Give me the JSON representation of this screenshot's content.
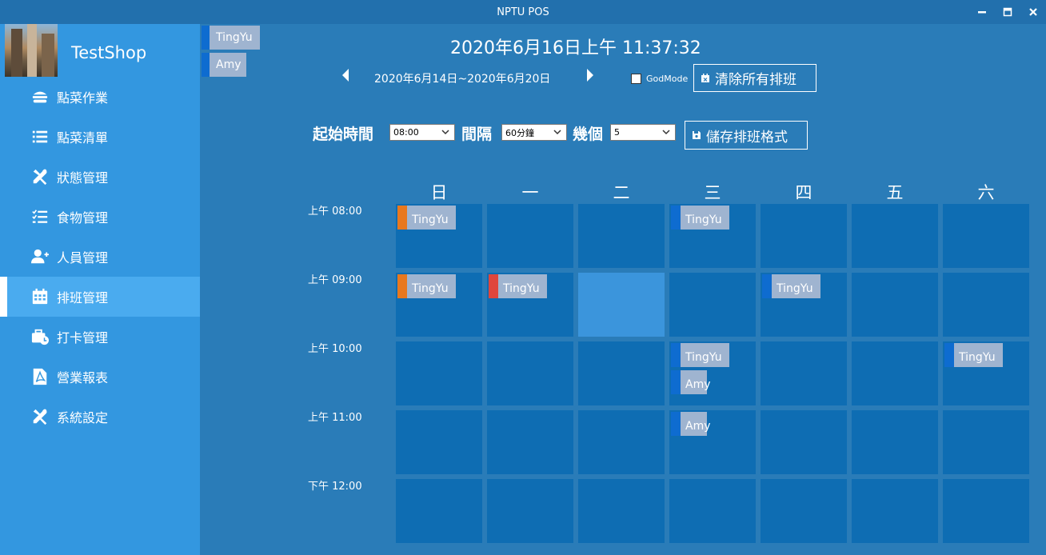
{
  "window": {
    "title": "NPTU POS"
  },
  "sidebar": {
    "shop_name": "TestShop",
    "items": [
      {
        "label": "點菜作業",
        "icon": "burger-icon",
        "active": false
      },
      {
        "label": "點菜清單",
        "icon": "list-icon",
        "active": false
      },
      {
        "label": "狀態管理",
        "icon": "tools-icon",
        "active": false
      },
      {
        "label": "食物管理",
        "icon": "checklist-icon",
        "active": false
      },
      {
        "label": "人員管理",
        "icon": "user-plus-icon",
        "active": false
      },
      {
        "label": "排班管理",
        "icon": "calendar-icon",
        "active": true
      },
      {
        "label": "打卡管理",
        "icon": "briefcase-clock-icon",
        "active": false
      },
      {
        "label": "營業報表",
        "icon": "pdf-file-icon",
        "active": false
      },
      {
        "label": "系統設定",
        "icon": "tools-icon",
        "active": false
      }
    ]
  },
  "employees": [
    "TingYu",
    "Amy"
  ],
  "header": {
    "datetime": "2020年6月16日上午 11:37:32",
    "week_range": "2020年6月14日~2020年6月20日",
    "godmode_label": "GodMode",
    "godmode_checked": false,
    "clear_button": "清除所有排班"
  },
  "options": {
    "start_label": "起始時間",
    "start_value": "08:00",
    "interval_label": "間隔",
    "interval_value": "60分鐘",
    "count_label": "幾個",
    "count_value": "5",
    "save_button": "儲存排班格式"
  },
  "schedule": {
    "days": [
      "日",
      "一",
      "二",
      "三",
      "四",
      "五",
      "六"
    ],
    "times": [
      "上午 08:00",
      "上午 09:00",
      "上午 10:00",
      "上午 11:00",
      "下午 12:00"
    ],
    "colors": {
      "orange": "#e8781e",
      "red": "#e0463c",
      "blue": "#0e6cd0"
    },
    "highlight": {
      "day": 2,
      "time": 1
    },
    "entries": [
      {
        "day": 0,
        "time": 0,
        "name": "TingYu",
        "color": "orange"
      },
      {
        "day": 3,
        "time": 0,
        "name": "TingYu",
        "color": "blue"
      },
      {
        "day": 0,
        "time": 1,
        "name": "TingYu",
        "color": "orange"
      },
      {
        "day": 1,
        "time": 1,
        "name": "TingYu",
        "color": "red"
      },
      {
        "day": 4,
        "time": 1,
        "name": "TingYu",
        "color": "blue"
      },
      {
        "day": 3,
        "time": 2,
        "name": "TingYu",
        "color": "blue"
      },
      {
        "day": 3,
        "time": 2,
        "name": "Amy",
        "color": "blue"
      },
      {
        "day": 6,
        "time": 2,
        "name": "TingYu",
        "color": "blue"
      },
      {
        "day": 3,
        "time": 3,
        "name": "Amy",
        "color": "blue"
      }
    ]
  }
}
